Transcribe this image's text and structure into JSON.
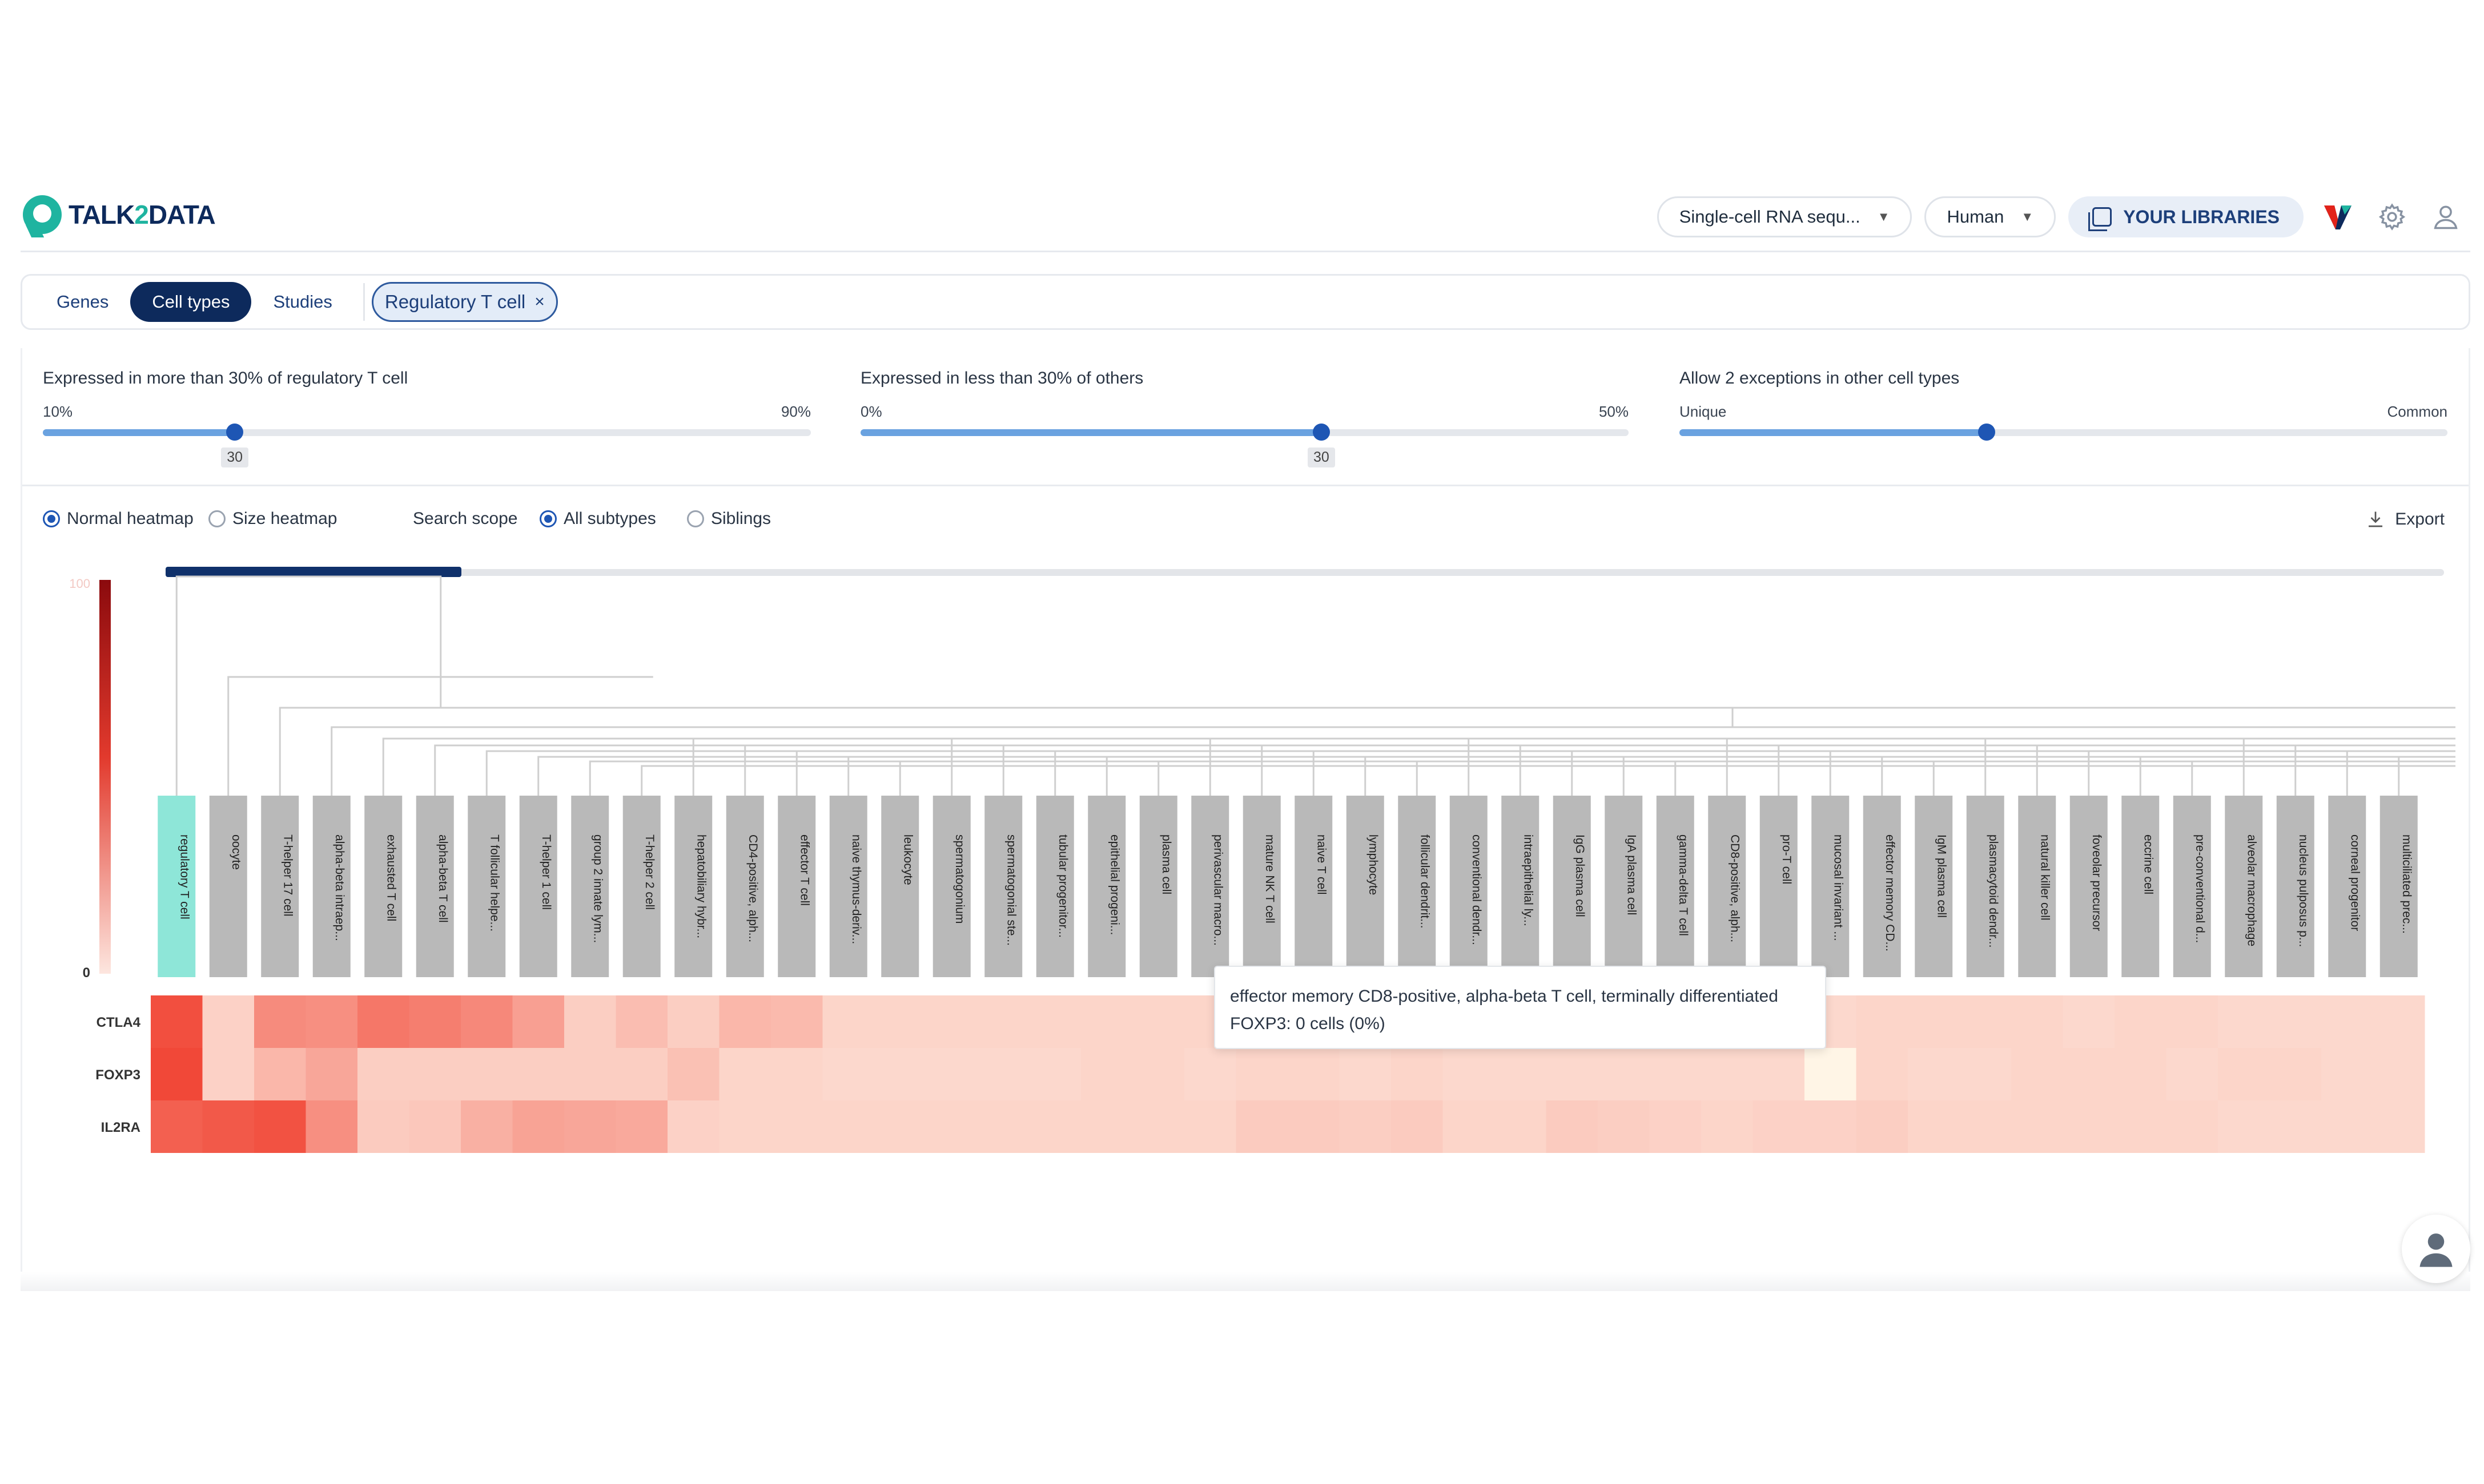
{
  "header": {
    "logo_text_a": "TALK",
    "logo_text_num": "2",
    "logo_text_b": "DATA",
    "dataset_select": "Single-cell RNA sequ...",
    "species_select": "Human",
    "libraries_label": "YOUR LIBRARIES"
  },
  "tabs": {
    "genes": "Genes",
    "cell_types": "Cell types",
    "studies": "Studies",
    "active": "Cell types"
  },
  "chip": {
    "label": "Regulatory T cell",
    "close": "×"
  },
  "sliders": [
    {
      "title": "Expressed in more than 30% of regulatory T cell",
      "lo": "10%",
      "hi": "90%",
      "value": 30,
      "value_label": "30",
      "min": 10,
      "max": 90
    },
    {
      "title": "Expressed in less than 30% of others",
      "lo": "0%",
      "hi": "50%",
      "value": 30,
      "value_label": "30",
      "min": 0,
      "max": 50
    },
    {
      "title": "Allow 2 exceptions in other cell types",
      "lo": "Unique",
      "hi": "Common",
      "value": 2,
      "min": 0,
      "max": 5
    }
  ],
  "controls": {
    "normal_heatmap": "Normal heatmap",
    "size_heatmap": "Size heatmap",
    "heatmap_mode": "Normal heatmap",
    "search_scope": "Search scope",
    "all_subtypes": "All subtypes",
    "siblings": "Siblings",
    "scope": "All subtypes",
    "export": "Export"
  },
  "tooltip": {
    "line1": "effector memory CD8-positive, alpha-beta T cell, terminally differentiated",
    "line2": "FOXP3: 0 cells (0%)"
  },
  "colors": {
    "brand_navy": "#0d2a5c",
    "brand_teal": "#1fb4a0",
    "accent_blue": "#1e56b4",
    "heat_high": "#f03b2a",
    "heat_low": "#fde1d6",
    "selected_col": "#8ee6d8"
  },
  "chart_data": {
    "type": "heatmap",
    "color_scale": {
      "min": 0,
      "max": 100,
      "min_label": "0",
      "max_label": "100"
    },
    "rows": [
      "CTLA4",
      "FOXP3",
      "IL2RA"
    ],
    "columns": [
      "regulatory T cell",
      "oocyte",
      "T-helper 17 cell",
      "alpha-beta intraep...",
      "exhausted T cell",
      "alpha-beta T cell",
      "T follicular helpe...",
      "T-helper 1 cell",
      "group 2 innate lym...",
      "T-helper 2 cell",
      "hepatobiliary hybr...",
      "CD4-positive, alph...",
      "effector T cell",
      "naive thymus-deriv...",
      "leukocyte",
      "spermatogonium",
      "spermatogonial ste...",
      "tubular progenitor...",
      "epithelial progeni...",
      "plasma cell",
      "perivascular macro...",
      "mature NK T cell",
      "naive T cell",
      "lymphocyte",
      "follicular dendrit...",
      "conventional dendr...",
      "intraepithelial ly...",
      "IgG plasma cell",
      "IgA plasma cell",
      "gamma-delta T cell",
      "CD8-positive, alph...",
      "pro-T cell",
      "mucosal invariant ...",
      "effector memory CD...",
      "IgM plasma cell",
      "plasmacytoid dendr...",
      "natural killer cell",
      "foveolar precursor",
      "eccrine cell",
      "pre-conventional d...",
      "alveolar macrophage",
      "nucleus pulposus p...",
      "corneal progenitor",
      "multiciliated prec..."
    ],
    "selected_column": "regulatory T cell",
    "values": [
      [
        88,
        10,
        52,
        50,
        64,
        60,
        54,
        40,
        12,
        22,
        12,
        26,
        24,
        8,
        8,
        8,
        8,
        8,
        8,
        8,
        8,
        8,
        6,
        6,
        8,
        8,
        8,
        8,
        8,
        8,
        6,
        8,
        6,
        8,
        8,
        8,
        8,
        6,
        8,
        8,
        6,
        6,
        6,
        6
      ],
      [
        92,
        10,
        26,
        36,
        12,
        12,
        12,
        12,
        12,
        12,
        20,
        8,
        8,
        6,
        6,
        6,
        6,
        6,
        8,
        8,
        6,
        8,
        8,
        6,
        8,
        6,
        6,
        6,
        6,
        6,
        6,
        6,
        0,
        8,
        6,
        6,
        8,
        8,
        8,
        6,
        8,
        8,
        6,
        6
      ],
      [
        78,
        82,
        86,
        50,
        14,
        16,
        30,
        38,
        36,
        34,
        10,
        8,
        8,
        8,
        8,
        8,
        8,
        8,
        8,
        8,
        8,
        14,
        14,
        12,
        14,
        8,
        8,
        14,
        12,
        10,
        8,
        10,
        10,
        12,
        8,
        8,
        8,
        8,
        8,
        8,
        6,
        6,
        6,
        6
      ]
    ]
  }
}
